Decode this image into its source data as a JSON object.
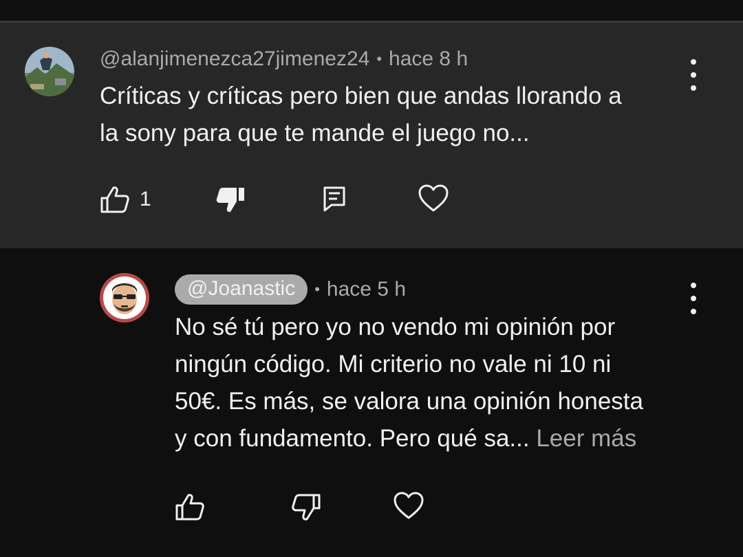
{
  "comments": [
    {
      "handle": "@alanjimenezca27jimenez24",
      "separator": "•",
      "time": "hace 8 h",
      "text_lines": [
        "Críticas y críticas pero bien que andas llorando a",
        "la sony para que te mande el juego no..."
      ],
      "like_count": "1",
      "highlighted": true,
      "disliked": true,
      "icons": [
        "thumb-up-icon",
        "thumb-down-filled-icon",
        "reply-icon",
        "heart-icon",
        "more-vert-icon"
      ]
    },
    {
      "handle": "@Joanastic",
      "separator": "•",
      "time": "hace 5 h",
      "text_lines": [
        "No sé tú pero yo no vendo mi opinión por",
        "ningún código. Mi criterio no vale ni 10 ni",
        "50€. Es más, se valora una opinión honesta",
        "y con fundamento. Pero qué sa..."
      ],
      "more_label": "Leer más",
      "creator_badge": true,
      "icons": [
        "thumb-up-icon",
        "thumb-down-icon",
        "heart-icon",
        "more-vert-icon"
      ]
    }
  ],
  "colors": {
    "background": "#0f0f0f",
    "highlight_background": "#272727",
    "text_primary": "#f1f1f1",
    "text_secondary": "#aaaaaa"
  }
}
